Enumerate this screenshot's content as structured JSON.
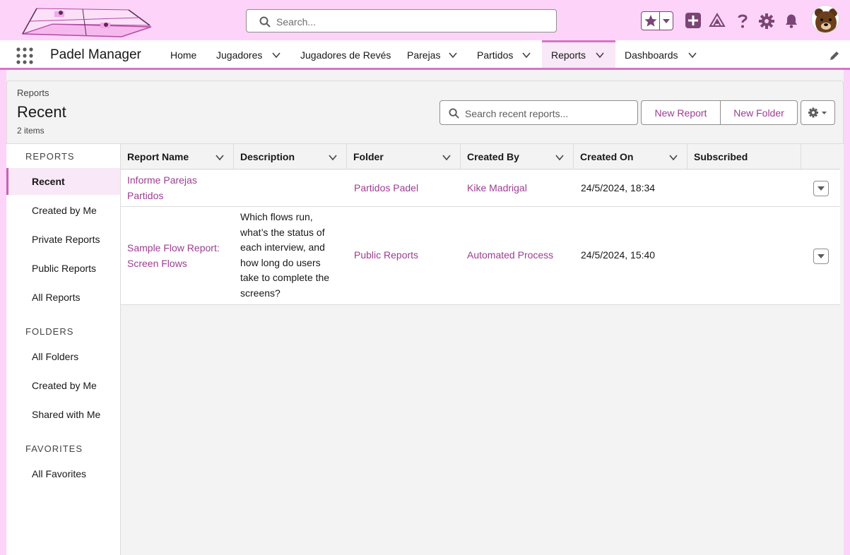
{
  "header": {
    "search_placeholder": "Search...",
    "icons": [
      "favorites-star-icon",
      "add-icon",
      "trailhead-icon",
      "help-icon",
      "setup-gear-icon",
      "notifications-bell-icon"
    ]
  },
  "nav": {
    "app_name": "Padel Manager",
    "items": [
      {
        "label": "Home"
      },
      {
        "label": "Jugadores"
      },
      {
        "label": "Jugadores de Revés"
      },
      {
        "label": "Parejas"
      },
      {
        "label": "Partidos"
      },
      {
        "label": "Reports"
      },
      {
        "label": "Dashboards"
      }
    ],
    "active": "Reports"
  },
  "page": {
    "breadcrumb": "Reports",
    "title": "Recent",
    "count": "2 items",
    "search_placeholder": "Search recent reports...",
    "new_report": "New Report",
    "new_folder": "New Folder"
  },
  "sidebar": {
    "reports_title": "REPORTS",
    "reports": [
      "Recent",
      "Created by Me",
      "Private Reports",
      "Public Reports",
      "All Reports"
    ],
    "folders_title": "FOLDERS",
    "folders": [
      "All Folders",
      "Created by Me",
      "Shared with Me"
    ],
    "favorites_title": "FAVORITES",
    "favorites": [
      "All Favorites"
    ],
    "active": "Recent"
  },
  "table": {
    "columns": [
      "Report Name",
      "Description",
      "Folder",
      "Created By",
      "Created On",
      "Subscribed"
    ],
    "rows": [
      {
        "name": "Informe Parejas Partidos",
        "description": "",
        "folder": "Partidos Padel",
        "created_by": "Kike Madrigal",
        "created_on": "24/5/2024, 18:34",
        "subscribed": ""
      },
      {
        "name": "Sample Flow Report: Screen Flows",
        "description": "Which flows run, what’s the status of each interview, and how long do users take to complete the screens?",
        "folder": "Public Reports",
        "created_by": "Automated Process",
        "created_on": "24/5/2024, 15:40",
        "subscribed": ""
      }
    ]
  },
  "colors": {
    "brand_pink": "#fdd3f9",
    "accent": "#d576c6",
    "link": "#9b3e92",
    "icon": "#7a4574"
  }
}
